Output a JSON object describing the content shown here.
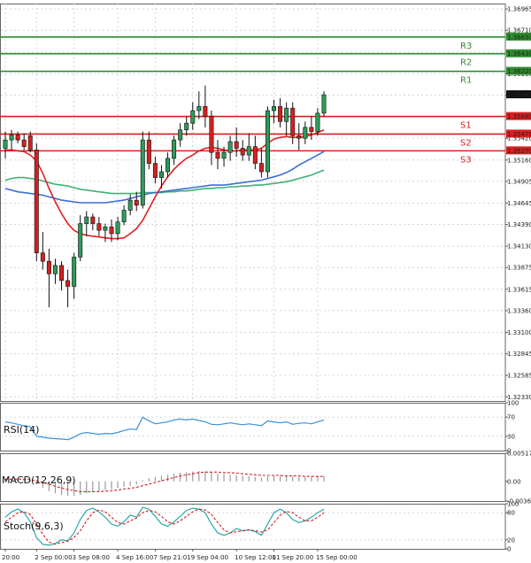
{
  "chart_data": {
    "type": "candlestick",
    "main": {
      "y_ticks": [
        "1.36965",
        "1.36710",
        "1.36450",
        "1.36190",
        "1.35935",
        "1.35680",
        "1.35420",
        "1.35160",
        "1.34905",
        "1.34645",
        "1.34390",
        "1.34130",
        "1.33875",
        "1.33615",
        "1.33360",
        "1.33100",
        "1.32845",
        "1.32585",
        "1.32330"
      ],
      "ylim": [
        1.3228,
        1.3703
      ],
      "last_price": "1.35940",
      "levels": [
        {
          "name": "R3",
          "value": "1.36630",
          "color": "#2e8b2e"
        },
        {
          "name": "R2",
          "value": "1.36430",
          "color": "#2e8b2e"
        },
        {
          "name": "R1",
          "value": "1.36220",
          "color": "#2e8b2e"
        },
        {
          "name": "S1",
          "value": "1.35680",
          "color": "#d42020"
        },
        {
          "name": "S2",
          "value": "1.35470",
          "color": "#d42020"
        },
        {
          "name": "S3",
          "value": "1.35270",
          "color": "#d42020"
        }
      ],
      "candles": [
        {
          "o": 1.353,
          "h": 1.355,
          "l": 1.3518,
          "c": 1.354
        },
        {
          "o": 1.354,
          "h": 1.3552,
          "l": 1.3528,
          "c": 1.3546
        },
        {
          "o": 1.3546,
          "h": 1.355,
          "l": 1.3536,
          "c": 1.354
        },
        {
          "o": 1.354,
          "h": 1.3548,
          "l": 1.3528,
          "c": 1.3532
        },
        {
          "o": 1.3545,
          "h": 1.355,
          "l": 1.3525,
          "c": 1.3528
        },
        {
          "o": 1.3528,
          "h": 1.3536,
          "l": 1.3395,
          "c": 1.3405
        },
        {
          "o": 1.3405,
          "h": 1.343,
          "l": 1.3385,
          "c": 1.3395
        },
        {
          "o": 1.3395,
          "h": 1.341,
          "l": 1.334,
          "c": 1.338
        },
        {
          "o": 1.338,
          "h": 1.3398,
          "l": 1.3368,
          "c": 1.339
        },
        {
          "o": 1.339,
          "h": 1.3395,
          "l": 1.336,
          "c": 1.3372
        },
        {
          "o": 1.3372,
          "h": 1.3385,
          "l": 1.334,
          "c": 1.3365
        },
        {
          "o": 1.3365,
          "h": 1.3405,
          "l": 1.335,
          "c": 1.34
        },
        {
          "o": 1.34,
          "h": 1.345,
          "l": 1.3395,
          "c": 1.344
        },
        {
          "o": 1.344,
          "h": 1.3455,
          "l": 1.3425,
          "c": 1.3448
        },
        {
          "o": 1.3448,
          "h": 1.3452,
          "l": 1.3432,
          "c": 1.344
        },
        {
          "o": 1.344,
          "h": 1.3448,
          "l": 1.3425,
          "c": 1.3432
        },
        {
          "o": 1.3432,
          "h": 1.344,
          "l": 1.3418,
          "c": 1.3436
        },
        {
          "o": 1.3436,
          "h": 1.3445,
          "l": 1.3418,
          "c": 1.3428
        },
        {
          "o": 1.3428,
          "h": 1.3448,
          "l": 1.342,
          "c": 1.3442
        },
        {
          "o": 1.3442,
          "h": 1.3462,
          "l": 1.3438,
          "c": 1.3456
        },
        {
          "o": 1.3456,
          "h": 1.3475,
          "l": 1.345,
          "c": 1.3468
        },
        {
          "o": 1.3468,
          "h": 1.3478,
          "l": 1.3455,
          "c": 1.3462
        },
        {
          "o": 1.3462,
          "h": 1.355,
          "l": 1.3458,
          "c": 1.354
        },
        {
          "o": 1.354,
          "h": 1.355,
          "l": 1.3505,
          "c": 1.3512
        },
        {
          "o": 1.3512,
          "h": 1.352,
          "l": 1.3488,
          "c": 1.3495
        },
        {
          "o": 1.3495,
          "h": 1.351,
          "l": 1.3482,
          "c": 1.3502
        },
        {
          "o": 1.3502,
          "h": 1.3525,
          "l": 1.3495,
          "c": 1.3518
        },
        {
          "o": 1.3518,
          "h": 1.3545,
          "l": 1.351,
          "c": 1.354
        },
        {
          "o": 1.354,
          "h": 1.356,
          "l": 1.3532,
          "c": 1.3552
        },
        {
          "o": 1.3552,
          "h": 1.3568,
          "l": 1.3545,
          "c": 1.356
        },
        {
          "o": 1.356,
          "h": 1.3585,
          "l": 1.3552,
          "c": 1.3575
        },
        {
          "o": 1.3575,
          "h": 1.3598,
          "l": 1.3565,
          "c": 1.358
        },
        {
          "o": 1.358,
          "h": 1.3605,
          "l": 1.3555,
          "c": 1.3568
        },
        {
          "o": 1.3568,
          "h": 1.3575,
          "l": 1.351,
          "c": 1.3525
        },
        {
          "o": 1.3525,
          "h": 1.354,
          "l": 1.3505,
          "c": 1.3518
        },
        {
          "o": 1.3518,
          "h": 1.3532,
          "l": 1.3508,
          "c": 1.3525
        },
        {
          "o": 1.3525,
          "h": 1.3545,
          "l": 1.3515,
          "c": 1.3538
        },
        {
          "o": 1.3538,
          "h": 1.3555,
          "l": 1.352,
          "c": 1.353
        },
        {
          "o": 1.353,
          "h": 1.354,
          "l": 1.3515,
          "c": 1.3522
        },
        {
          "o": 1.3522,
          "h": 1.3548,
          "l": 1.3515,
          "c": 1.3532
        },
        {
          "o": 1.3532,
          "h": 1.3545,
          "l": 1.3505,
          "c": 1.3512
        },
        {
          "o": 1.3512,
          "h": 1.353,
          "l": 1.3495,
          "c": 1.3502
        },
        {
          "o": 1.3502,
          "h": 1.358,
          "l": 1.3495,
          "c": 1.3575
        },
        {
          "o": 1.3575,
          "h": 1.3588,
          "l": 1.356,
          "c": 1.358
        },
        {
          "o": 1.358,
          "h": 1.359,
          "l": 1.3555,
          "c": 1.3562
        },
        {
          "o": 1.3562,
          "h": 1.3585,
          "l": 1.3545,
          "c": 1.3578
        },
        {
          "o": 1.3578,
          "h": 1.3585,
          "l": 1.3535,
          "c": 1.3545
        },
        {
          "o": 1.3545,
          "h": 1.356,
          "l": 1.3528,
          "c": 1.3542
        },
        {
          "o": 1.3542,
          "h": 1.3562,
          "l": 1.3535,
          "c": 1.3555
        },
        {
          "o": 1.3555,
          "h": 1.3568,
          "l": 1.354,
          "c": 1.355
        },
        {
          "o": 1.355,
          "h": 1.3578,
          "l": 1.3545,
          "c": 1.3572
        },
        {
          "o": 1.3572,
          "h": 1.3598,
          "l": 1.3568,
          "c": 1.3594
        }
      ],
      "ma_fast": [
        1.3528,
        1.3528,
        1.3527,
        1.3526,
        1.3522,
        1.3515,
        1.35,
        1.3482,
        1.3466,
        1.3452,
        1.344,
        1.3432,
        1.3428,
        1.3426,
        1.3425,
        1.3424,
        1.3423,
        1.3422,
        1.3422,
        1.3423,
        1.3428,
        1.3434,
        1.3444,
        1.3458,
        1.3472,
        1.3485,
        1.3496,
        1.3505,
        1.3512,
        1.3518,
        1.3522,
        1.3527,
        1.353,
        1.3531,
        1.353,
        1.3528,
        1.3527,
        1.3527,
        1.3528,
        1.3528,
        1.3528,
        1.353,
        1.3536,
        1.3541,
        1.3543,
        1.3544,
        1.3543,
        1.3543,
        1.3544,
        1.3546,
        1.3549,
        1.3552
      ],
      "ma_mid": [
        1.3482,
        1.348,
        1.3478,
        1.3477,
        1.3476,
        1.3475,
        1.3474,
        1.3472,
        1.347,
        1.3468,
        1.3467,
        1.3466,
        1.3465,
        1.3465,
        1.3465,
        1.3465,
        1.3465,
        1.3466,
        1.3467,
        1.3468,
        1.347,
        1.3472,
        1.3474,
        1.3476,
        1.3477,
        1.3478,
        1.3479,
        1.348,
        1.3481,
        1.3482,
        1.3483,
        1.3484,
        1.3485,
        1.3486,
        1.3486,
        1.3486,
        1.3487,
        1.3488,
        1.3489,
        1.349,
        1.3491,
        1.3492,
        1.3494,
        1.3496,
        1.3498,
        1.3501,
        1.3505,
        1.351,
        1.3514,
        1.3518,
        1.3522,
        1.3526
      ],
      "ma_slow": [
        1.3492,
        1.3494,
        1.3495,
        1.3495,
        1.3494,
        1.3493,
        1.3491,
        1.3489,
        1.3487,
        1.3486,
        1.3485,
        1.3483,
        1.3481,
        1.348,
        1.3479,
        1.3478,
        1.3477,
        1.3476,
        1.3476,
        1.3476,
        1.3476,
        1.3476,
        1.3477,
        1.3477,
        1.3477,
        1.3477,
        1.3478,
        1.3478,
        1.3479,
        1.3479,
        1.348,
        1.3481,
        1.3482,
        1.3482,
        1.3483,
        1.3483,
        1.3484,
        1.3484,
        1.3485,
        1.3485,
        1.3486,
        1.3486,
        1.3487,
        1.3488,
        1.3489,
        1.349,
        1.3492,
        1.3494,
        1.3496,
        1.3498,
        1.3501,
        1.3504
      ]
    },
    "x_ticks": [
      {
        "label": "20:00",
        "i": 0
      },
      {
        "label": "2 Sep 00:00",
        "i": 5
      },
      {
        "label": "3 Sep 08:00",
        "i": 11
      },
      {
        "label": "4 Sep 16:00",
        "i": 18
      },
      {
        "label": "7 Sep 21:01",
        "i": 24
      },
      {
        "label": "9 Sep 04:00",
        "i": 30
      },
      {
        "label": "10 Sep 12:00",
        "i": 37
      },
      {
        "label": "11 Sep 20:00",
        "i": 43
      },
      {
        "label": "15 Sep 00:00",
        "i": 50
      }
    ],
    "rsi": {
      "label": "RSI(14)",
      "ticks": [
        "100",
        "70",
        "30",
        "0"
      ],
      "ylim": [
        0,
        100
      ],
      "values": [
        60,
        58,
        55,
        52,
        50,
        30,
        28,
        26,
        25,
        24,
        23,
        28,
        35,
        38,
        36,
        34,
        36,
        35,
        38,
        42,
        45,
        44,
        70,
        62,
        56,
        58,
        60,
        64,
        66,
        64,
        66,
        63,
        60,
        55,
        54,
        56,
        58,
        56,
        54,
        56,
        54,
        52,
        62,
        60,
        58,
        60,
        55,
        57,
        58,
        56,
        60,
        64
      ]
    },
    "macd": {
      "label": "MACD(12,26,9)",
      "ticks": [
        "0.005174",
        "0.00",
        "-0.003625"
      ],
      "ylim": [
        -0.003625,
        0.005174
      ],
      "hist": [
        0.0005,
        0.0005,
        0.0004,
        0.0003,
        0.0002,
        -0.0006,
        -0.0012,
        -0.0018,
        -0.0022,
        -0.0025,
        -0.0027,
        -0.0027,
        -0.0025,
        -0.0022,
        -0.002,
        -0.0018,
        -0.0016,
        -0.0014,
        -0.0012,
        -0.001,
        -0.0008,
        -0.0006,
        0.0002,
        0.0006,
        0.0008,
        0.001,
        0.0012,
        0.0014,
        0.0016,
        0.0017,
        0.0018,
        0.0019,
        0.0018,
        0.0016,
        0.0014,
        0.0013,
        0.0012,
        0.0011,
        0.001,
        0.0009,
        0.0008,
        0.0007,
        0.0009,
        0.001,
        0.001,
        0.001,
        0.0009,
        0.0008,
        0.0008,
        0.0008,
        0.0009,
        0.001
      ],
      "signal": [
        0.0004,
        0.0004,
        0.0004,
        0.0004,
        0.0003,
        0.0001,
        -0.0002,
        -0.0005,
        -0.0009,
        -0.0012,
        -0.0015,
        -0.0017,
        -0.0019,
        -0.0019,
        -0.0019,
        -0.0019,
        -0.0018,
        -0.0017,
        -0.0016,
        -0.0014,
        -0.0013,
        -0.0011,
        -0.0008,
        -0.0005,
        -0.0002,
        0.0001,
        0.0004,
        0.0007,
        0.001,
        0.0012,
        0.0014,
        0.0016,
        0.0017,
        0.0017,
        0.0017,
        0.0016,
        0.0016,
        0.0015,
        0.0014,
        0.0013,
        0.0012,
        0.0011,
        0.0011,
        0.0011,
        0.0011,
        0.001,
        0.001,
        0.001,
        0.0009,
        0.0009,
        0.0009,
        0.0009
      ]
    },
    "stoch": {
      "label": "Stoch(9,6,3)",
      "ticks": [
        "100",
        "80",
        "20",
        "0"
      ],
      "ylim": [
        0,
        100
      ],
      "k": [
        70,
        82,
        88,
        80,
        60,
        25,
        10,
        8,
        12,
        20,
        18,
        35,
        65,
        85,
        90,
        82,
        70,
        55,
        50,
        60,
        75,
        70,
        92,
        88,
        72,
        55,
        50,
        60,
        72,
        85,
        90,
        88,
        80,
        55,
        35,
        30,
        35,
        45,
        40,
        42,
        38,
        30,
        55,
        80,
        88,
        80,
        65,
        58,
        62,
        70,
        80,
        88
      ],
      "d": [
        60,
        70,
        80,
        82,
        76,
        55,
        32,
        15,
        10,
        14,
        17,
        25,
        40,
        62,
        80,
        86,
        82,
        70,
        58,
        55,
        62,
        68,
        80,
        85,
        82,
        72,
        60,
        55,
        62,
        72,
        82,
        88,
        86,
        76,
        58,
        42,
        35,
        38,
        40,
        42,
        40,
        37,
        42,
        58,
        75,
        83,
        80,
        70,
        62,
        62,
        70,
        80
      ]
    }
  }
}
